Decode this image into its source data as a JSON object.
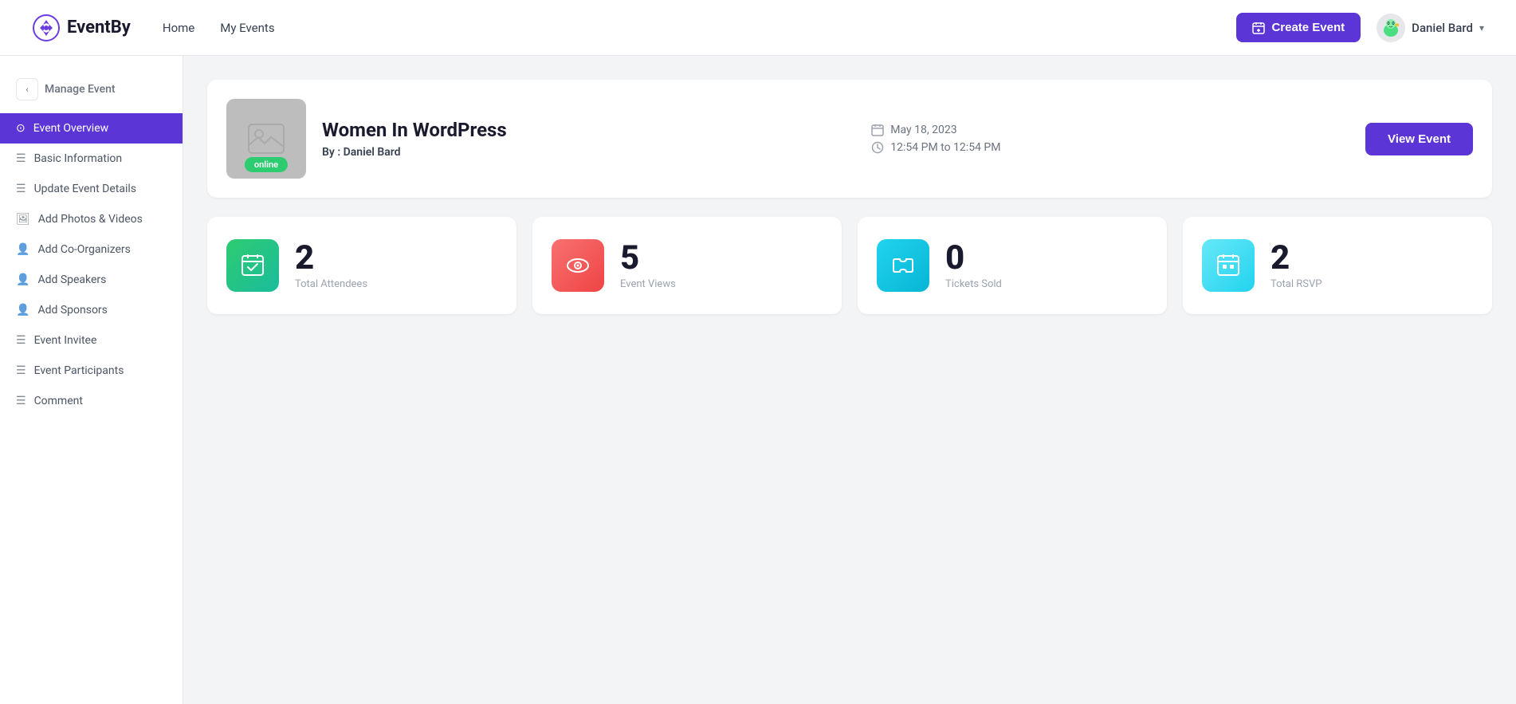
{
  "header": {
    "logo_text": "EventBy",
    "nav": [
      {
        "label": "Home",
        "id": "home"
      },
      {
        "label": "My Events",
        "id": "my-events"
      }
    ],
    "create_event_label": "Create Event",
    "user_name": "Daniel Bard",
    "chevron": "▾"
  },
  "sidebar": {
    "collapse_icon": "‹",
    "manage_label": "Manage Event",
    "items": [
      {
        "id": "event-overview",
        "label": "Event Overview",
        "icon": "⊙",
        "active": true
      },
      {
        "id": "basic-information",
        "label": "Basic Information",
        "icon": "☰",
        "active": false
      },
      {
        "id": "update-event-details",
        "label": "Update Event Details",
        "icon": "☰",
        "active": false
      },
      {
        "id": "add-photos-videos",
        "label": "Add Photos & Videos",
        "icon": "🖼",
        "active": false
      },
      {
        "id": "add-co-organizers",
        "label": "Add Co-Organizers",
        "icon": "👤",
        "active": false
      },
      {
        "id": "add-speakers",
        "label": "Add Speakers",
        "icon": "👤",
        "active": false
      },
      {
        "id": "add-sponsors",
        "label": "Add Sponsors",
        "icon": "👤",
        "active": false
      },
      {
        "id": "event-invitee",
        "label": "Event Invitee",
        "icon": "☰",
        "active": false
      },
      {
        "id": "event-participants",
        "label": "Event Participants",
        "icon": "☰",
        "active": false
      },
      {
        "id": "comment",
        "label": "Comment",
        "icon": "☰",
        "active": false
      }
    ]
  },
  "event": {
    "title": "Women In WordPress",
    "author_prefix": "By :",
    "author": "Daniel Bard",
    "status": "online",
    "date": "May 18, 2023",
    "time": "12:54 PM to 12:54 PM",
    "view_event_label": "View Event"
  },
  "stats": [
    {
      "id": "total-attendees",
      "value": "2",
      "label": "Total Attendees",
      "color": "green"
    },
    {
      "id": "event-views",
      "value": "5",
      "label": "Event Views",
      "color": "red"
    },
    {
      "id": "tickets-sold",
      "value": "0",
      "label": "Tickets Sold",
      "color": "cyan"
    },
    {
      "id": "total-rsvp",
      "value": "2",
      "label": "Total RSVP",
      "color": "light-cyan"
    }
  ]
}
